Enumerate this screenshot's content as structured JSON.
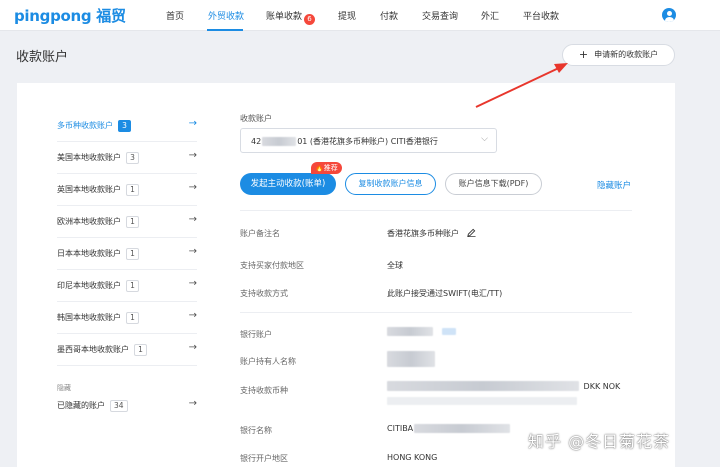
{
  "app": {
    "logo": "pingpong 福贸"
  },
  "nav": {
    "items": [
      "首页",
      "外贸收款",
      "账单收款",
      "提现",
      "付款",
      "交易查询",
      "外汇",
      "平台收款"
    ],
    "active": "外贸收款",
    "fire_badge": "6"
  },
  "page": {
    "title": "收款账户",
    "apply_button": "申请新的收款账户",
    "apply_icon": "+"
  },
  "sidebar": {
    "items": [
      {
        "label": "多币种收款账户",
        "count": "3",
        "active": true
      },
      {
        "label": "美国本地收款账户",
        "count": "3"
      },
      {
        "label": "英国本地收款账户",
        "count": "1"
      },
      {
        "label": "欧洲本地收款账户",
        "count": "1"
      },
      {
        "label": "日本本地收款账户",
        "count": "1"
      },
      {
        "label": "印尼本地收款账户",
        "count": "1"
      },
      {
        "label": "韩国本地收款账户",
        "count": "1"
      },
      {
        "label": "墨西哥本地收款账户",
        "count": "1"
      }
    ],
    "section_label": "隐藏",
    "hidden": {
      "label": "已隐藏的账户",
      "count": "34"
    },
    "arrow_icon": "→"
  },
  "main": {
    "account_label": "收款账户",
    "account_value_prefix": "42",
    "account_value_suffix": "01 (香港花旗多币种账户) CITI香港银行",
    "hot_tag": "推荐",
    "actions": {
      "primary": "发起主动收款(账单)",
      "copy": "复制收款账户信息",
      "download": "账户信息下载(PDF)",
      "hide": "隐藏账户"
    },
    "details": [
      {
        "label": "账户备注名",
        "value": "香港花旗多币种账户"
      },
      {
        "label": "支持买家付款地区",
        "value": "全球"
      },
      {
        "label": "支持收款方式",
        "value": "此账户接受通过SWIFT(电汇/TT)"
      }
    ],
    "bank": [
      {
        "label": "银行账户",
        "value": ""
      },
      {
        "label": "账户持有人名称",
        "value": ""
      },
      {
        "label": "支持收款币种",
        "value": "DKK NOK"
      },
      {
        "label": "银行名称",
        "value": "CITIBA"
      },
      {
        "label": "银行开户地区",
        "value": "HONG KONG"
      }
    ]
  },
  "watermark": "知乎 @冬日菊花茶",
  "colors": {
    "accent": "#1c8ce3",
    "danger": "#f5483b",
    "arrow": "#e8362c"
  }
}
